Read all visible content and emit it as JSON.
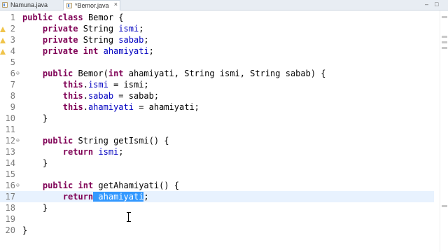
{
  "tabs": [
    {
      "label": "Namuna.java",
      "icon": "java-file-icon",
      "active": false
    },
    {
      "label": "*Bemor.java",
      "icon": "java-file-icon",
      "active": true
    }
  ],
  "tab_close_glyph": "×",
  "window_controls": {
    "minimize": "–",
    "maximize": "□"
  },
  "colors": {
    "keyword": "#7f0055",
    "field": "#0000c0",
    "selection": "#3399ff",
    "current_line": "#e8f2fe",
    "line_number": "#7a7a7a"
  },
  "editor": {
    "lines": [
      {
        "num": "1",
        "text": "public class Bemor {"
      },
      {
        "num": "2",
        "text": "    private String ismi;"
      },
      {
        "num": "3",
        "text": "    private String sabab;"
      },
      {
        "num": "4",
        "text": "    private int ahamiyati;"
      },
      {
        "num": "5",
        "text": ""
      },
      {
        "num": "6",
        "text": "    public Bemor(int ahamiyati, String ismi, String sabab) {"
      },
      {
        "num": "7",
        "text": "        this.ismi = ismi;"
      },
      {
        "num": "8",
        "text": "        this.sabab = sabab;"
      },
      {
        "num": "9",
        "text": "        this.ahamiyati = ahamiyati;"
      },
      {
        "num": "10",
        "text": "    }"
      },
      {
        "num": "11",
        "text": ""
      },
      {
        "num": "12",
        "text": "    public String getIsmi() {"
      },
      {
        "num": "13",
        "text": "        return ismi;"
      },
      {
        "num": "14",
        "text": "    }"
      },
      {
        "num": "15",
        "text": ""
      },
      {
        "num": "16",
        "text": "    public int getAhamiyati() {"
      },
      {
        "num": "17",
        "text": "        return ahamiyati;"
      },
      {
        "num": "18",
        "text": "    }"
      },
      {
        "num": "19",
        "text": ""
      },
      {
        "num": "20",
        "text": "}"
      }
    ],
    "current_line": "17",
    "selected_text": "ahamiyati"
  }
}
